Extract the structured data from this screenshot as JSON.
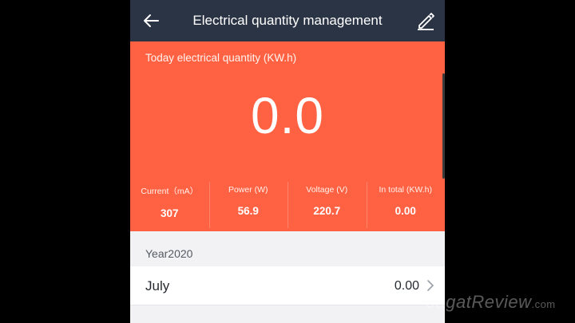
{
  "appbar": {
    "title": "Electrical quantity management",
    "back_icon": "arrow-left-icon",
    "edit_icon": "pencil-icon"
  },
  "today": {
    "label": "Today electrical quantity (KW.h)",
    "value": "0.0"
  },
  "stats": [
    {
      "label": "Current（mA）",
      "value": "307"
    },
    {
      "label": "Power (W)",
      "value": "56.9"
    },
    {
      "label": "Voltage (V)",
      "value": "220.7"
    },
    {
      "label": "In total (KW.h)",
      "value": "0.00"
    }
  ],
  "history": {
    "year_label": "Year2020",
    "months": [
      {
        "name": "July",
        "value": "0.00"
      }
    ]
  },
  "watermark": {
    "brand": "JagatReview",
    "suffix": ".com"
  },
  "colors": {
    "appbar": "#2b3445",
    "accent": "#ff6243",
    "background": "#f2f2f4"
  }
}
